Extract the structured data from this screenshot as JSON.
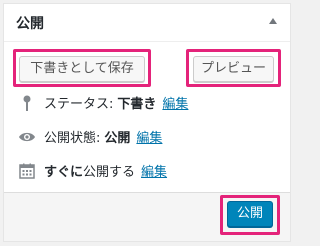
{
  "box": {
    "title": "公開"
  },
  "actions": {
    "save_draft_label": "下書きとして保存",
    "preview_label": "プレビュー"
  },
  "misc": {
    "status_label": "ステータス:",
    "status_value": "下書き",
    "status_edit": "編集",
    "visibility_label": "公開状態:",
    "visibility_value": "公開",
    "visibility_edit": "編集",
    "schedule_prefix": "すぐに",
    "schedule_label": "公開する",
    "schedule_edit": "編集"
  },
  "footer": {
    "publish_label": "公開"
  },
  "colors": {
    "highlight": "#e4237a",
    "primary": "#0085ba",
    "link": "#0073aa"
  },
  "icons": {
    "status": "pin-icon",
    "visibility": "eye-icon",
    "schedule": "calendar-icon",
    "toggle": "triangle-up-icon"
  }
}
